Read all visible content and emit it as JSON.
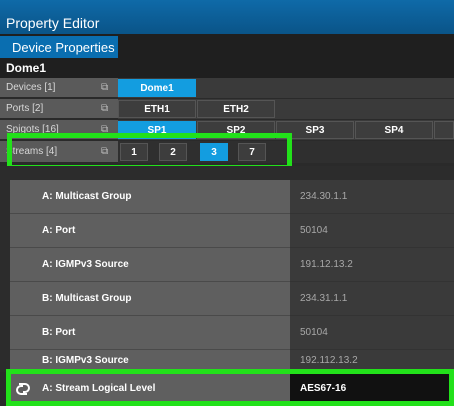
{
  "window": {
    "title": "Property Editor"
  },
  "tabs": [
    {
      "label": "Device Properties",
      "active": true
    }
  ],
  "device": {
    "name": "Dome1"
  },
  "rows": {
    "devices": {
      "label": "Devices [1]",
      "items": [
        "Dome1"
      ],
      "selected": 0
    },
    "ports": {
      "label": "Ports [2]",
      "items": [
        "ETH1",
        "ETH2"
      ],
      "selected": -1
    },
    "spigots": {
      "label": "Spigots [16]",
      "items": [
        "SP1",
        "SP2",
        "SP3",
        "SP4"
      ],
      "selected": 0
    },
    "streams": {
      "label": "Streams [4]",
      "items": [
        "1",
        "2",
        "3",
        "7"
      ],
      "selected": 2
    }
  },
  "properties": [
    {
      "name": "A: Multicast Group",
      "value": "234.30.1.1"
    },
    {
      "name": "A: Port",
      "value": "50104"
    },
    {
      "name": "A: IGMPv3 Source",
      "value": "191.12.13.2"
    },
    {
      "name": "B: Multicast Group",
      "value": "234.31.1.1"
    },
    {
      "name": "B: Port",
      "value": "50104"
    },
    {
      "name": "B: IGMPv3 Source",
      "value": "192.112.13.2"
    }
  ],
  "logical_level": {
    "name": "A: Stream Logical Level",
    "value": "AES67-16"
  },
  "colors": {
    "accent": "#139de0",
    "highlight": "#22e11a",
    "titlebar": "#0a5488"
  },
  "icons": {
    "filter": "filter-icon",
    "link": "link-icon"
  }
}
